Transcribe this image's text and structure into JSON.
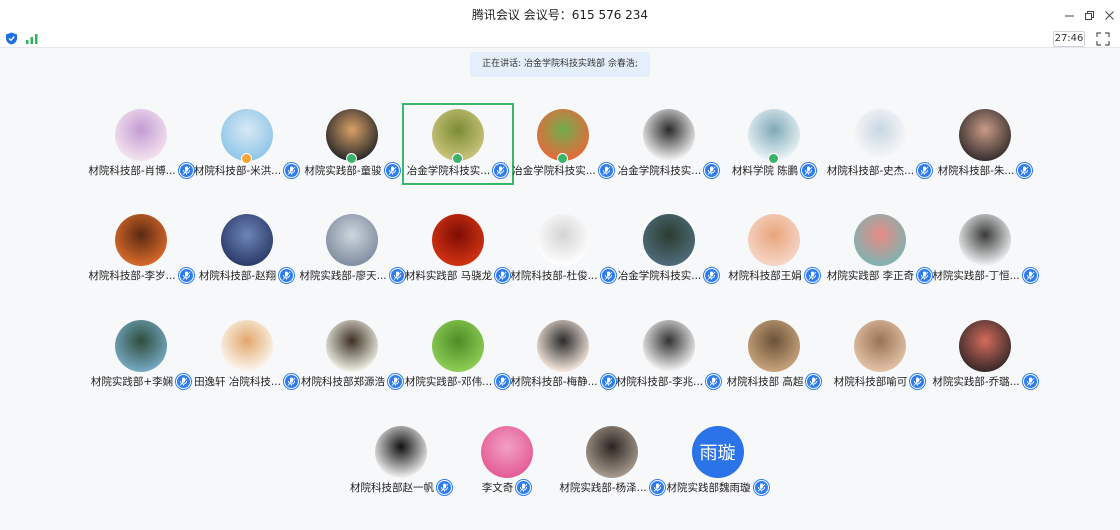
{
  "window": {
    "title": "腾讯会议 会议号：615 576 234"
  },
  "toolbar": {
    "timer": "27:46"
  },
  "speaking": {
    "text": "正在讲话: 冶金学院科技实践部 佘春浩;"
  },
  "participants": [
    {
      "name": "材院科技部-肖博...",
      "avatar_colors": [
        "#f3e2ee",
        "#c39bd3"
      ],
      "badge": ""
    },
    {
      "name": "材院科技部-米洪...",
      "avatar_colors": [
        "#8fc6e8",
        "#d8e9f4"
      ],
      "badge": "#f0a534"
    },
    {
      "name": "材院实践部-童骏",
      "avatar_colors": [
        "#2b2b2b",
        "#d9a066"
      ],
      "badge": "#3cb36a"
    },
    {
      "name": "冶金学院科技实...",
      "avatar_colors": [
        "#c9c37a",
        "#7b8c33"
      ],
      "badge": "#3cb36a",
      "active": true
    },
    {
      "name": "冶金学院科技实...",
      "avatar_colors": [
        "#e56a3a",
        "#6fae4f"
      ],
      "badge": "#3cb36a"
    },
    {
      "name": "冶金学院科技实...",
      "avatar_colors": [
        "#f2f2f2",
        "#2a2a2a"
      ],
      "badge": ""
    },
    {
      "name": "材料学院 陈鹏",
      "avatar_colors": [
        "#e9f3f5",
        "#7fa9b8"
      ],
      "badge": "#3cb36a"
    },
    {
      "name": "材院科技部-史杰...",
      "avatar_colors": [
        "#fafafa",
        "#c9d7e3"
      ],
      "badge": ""
    },
    {
      "name": "材院科技部-朱...",
      "avatar_colors": [
        "#3a3030",
        "#c89c87"
      ],
      "badge": ""
    },
    {
      "name": "材院科技部-李岁...",
      "avatar_colors": [
        "#d8692a",
        "#5a2a12"
      ],
      "badge": ""
    },
    {
      "name": "材院科技部-赵翔",
      "avatar_colors": [
        "#2c3b6a",
        "#6d86b9"
      ],
      "badge": ""
    },
    {
      "name": "材院实践部-廖天...",
      "avatar_colors": [
        "#7f8ea0",
        "#cfd6df"
      ],
      "badge": ""
    },
    {
      "name": "材料实践部 马骁龙",
      "avatar_colors": [
        "#d23311",
        "#7d0d05"
      ],
      "badge": ""
    },
    {
      "name": "材院科技部-杜俊...",
      "avatar_colors": [
        "#ffffff",
        "#d4d4d4"
      ],
      "badge": ""
    },
    {
      "name": "冶金学院科技实...",
      "avatar_colors": [
        "#4e6b7a",
        "#2b3d2f"
      ],
      "badge": ""
    },
    {
      "name": "材院科技部王娟",
      "avatar_colors": [
        "#f6d5c7",
        "#e9a57c"
      ],
      "badge": ""
    },
    {
      "name": "材院实践部 李正奇",
      "avatar_colors": [
        "#7fb3b1",
        "#e98a82"
      ],
      "badge": ""
    },
    {
      "name": "材院实践部-丁恒...",
      "avatar_colors": [
        "#eef1f2",
        "#3a3a3a"
      ],
      "badge": ""
    },
    {
      "name": "材院实践部+李娴",
      "avatar_colors": [
        "#75a8c2",
        "#2e4d3c"
      ],
      "badge": ""
    },
    {
      "name": "田逸轩 冶院科技...",
      "avatar_colors": [
        "#fbf7ef",
        "#e2a76b"
      ],
      "badge": ""
    },
    {
      "name": "材院科技部郑源浩",
      "avatar_colors": [
        "#efefe6",
        "#3e3122"
      ],
      "badge": ""
    },
    {
      "name": "材院实践部-邓伟...",
      "avatar_colors": [
        "#8dce55",
        "#4d8c24"
      ],
      "badge": ""
    },
    {
      "name": "材院科技部-梅静...",
      "avatar_colors": [
        "#f4e6dc",
        "#2b2b2b"
      ],
      "badge": ""
    },
    {
      "name": "材院科技部-李兆...",
      "avatar_colors": [
        "#f3f3f3",
        "#333333"
      ],
      "badge": ""
    },
    {
      "name": "材院科技部 高超",
      "avatar_colors": [
        "#c7a37b",
        "#6b5238"
      ],
      "badge": ""
    },
    {
      "name": "材院科技部喻可",
      "avatar_colors": [
        "#e3c2a6",
        "#9a7355"
      ],
      "badge": ""
    },
    {
      "name": "材院实践部-乔璐...",
      "avatar_colors": [
        "#3a2a2a",
        "#d46b5a"
      ],
      "badge": ""
    },
    {
      "name": "材院科技部赵一帆",
      "avatar_colors": [
        "#eeeeee",
        "#111111"
      ],
      "badge": ""
    },
    {
      "name": "李文奇",
      "avatar_colors": [
        "#e45c96",
        "#f2a1c4"
      ],
      "badge": ""
    },
    {
      "name": "材院实践部-杨泽...",
      "avatar_colors": [
        "#a89a8e",
        "#2a2521"
      ],
      "badge": ""
    },
    {
      "name": "材院实践部魏雨璇",
      "avatar_text": "雨璇",
      "avatar_colors": [
        "#2a73e8",
        "#2a73e8"
      ],
      "badge": ""
    }
  ]
}
